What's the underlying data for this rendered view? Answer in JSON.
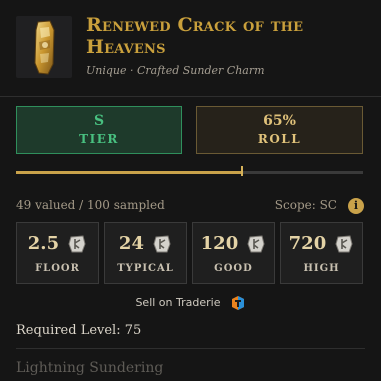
{
  "item": {
    "title": "Renewed Crack of the Heavens",
    "subtitle": "Unique · Crafted Sunder Charm",
    "icon": "sunder-charm-icon"
  },
  "tier": {
    "value": "S",
    "label": "TIER",
    "color": "#48c080"
  },
  "roll": {
    "value": "65%",
    "label": "ROLL",
    "fraction": 0.65,
    "color": "#c9a24a"
  },
  "stats": {
    "summary": "49 valued / 100 sampled",
    "scope": "Scope: SC",
    "info_glyph": "i"
  },
  "prices": [
    {
      "value": "2.5",
      "label": "FLOOR",
      "icon": "rune-icon"
    },
    {
      "value": "24",
      "label": "TYPICAL",
      "icon": "rune-icon"
    },
    {
      "value": "120",
      "label": "GOOD",
      "icon": "rune-icon"
    },
    {
      "value": "720",
      "label": "HIGH",
      "icon": "rune-icon"
    }
  ],
  "sell": {
    "label": "Sell on Traderie",
    "icon": "traderie-icon"
  },
  "requirement": {
    "label": "Required Level:",
    "value": "75"
  },
  "mods": [
    "Lightning Sundering"
  ],
  "colors": {
    "accent_gold": "#c9a03c",
    "background": "#151515",
    "card": "#1f1f1f"
  }
}
